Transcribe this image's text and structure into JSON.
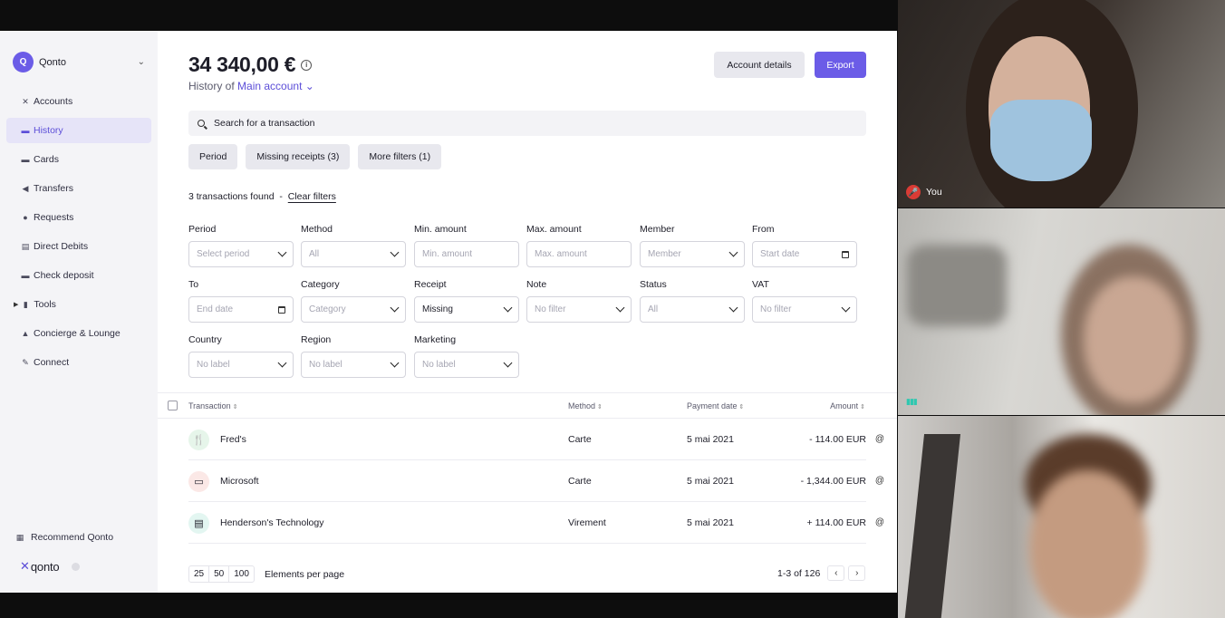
{
  "org": {
    "initial": "Q",
    "name": "Qonto"
  },
  "nav": [
    {
      "label": "Accounts",
      "icon": "accounts-icon",
      "glyph": "✕"
    },
    {
      "label": "History",
      "icon": "history-icon",
      "glyph": "▬"
    },
    {
      "label": "Cards",
      "icon": "cards-icon",
      "glyph": "▬"
    },
    {
      "label": "Transfers",
      "icon": "transfers-icon",
      "glyph": "◀"
    },
    {
      "label": "Requests",
      "icon": "requests-icon",
      "glyph": "●"
    },
    {
      "label": "Direct Debits",
      "icon": "direct-debits-icon",
      "glyph": "▤"
    },
    {
      "label": "Check deposit",
      "icon": "check-deposit-icon",
      "glyph": "▬"
    },
    {
      "label": "Tools",
      "icon": "tools-icon",
      "glyph": "▮"
    },
    {
      "label": "Concierge & Lounge",
      "icon": "concierge-icon",
      "glyph": "▲"
    },
    {
      "label": "Connect",
      "icon": "connect-icon",
      "glyph": "✎"
    }
  ],
  "recommend": {
    "label": "Recommend Qonto"
  },
  "brand": {
    "word": "qonto"
  },
  "header": {
    "balance": "34 340,00 €",
    "history_prefix": "History of",
    "account": "Main account",
    "details_label": "Account details",
    "export_label": "Export"
  },
  "search": {
    "placeholder": "Search for a transaction"
  },
  "chips": [
    "Period",
    "Missing receipts (3)",
    "More filters (1)"
  ],
  "results": {
    "found": "3 transactions found",
    "sep": "-",
    "clear": "Clear filters"
  },
  "filters": [
    {
      "label": "Period",
      "value": "Select period",
      "kind": "select"
    },
    {
      "label": "Method",
      "value": "All",
      "kind": "select"
    },
    {
      "label": "Min. amount",
      "value": "Min. amount",
      "kind": "input"
    },
    {
      "label": "Max. amount",
      "value": "Max. amount",
      "kind": "input"
    },
    {
      "label": "Member",
      "value": "Member",
      "kind": "select"
    },
    {
      "label": "From",
      "value": "Start date",
      "kind": "date"
    },
    {
      "label": "To",
      "value": "End date",
      "kind": "date"
    },
    {
      "label": "Category",
      "value": "Category",
      "kind": "select"
    },
    {
      "label": "Receipt",
      "value": "Missing",
      "kind": "select",
      "set": true
    },
    {
      "label": "Note",
      "value": "No filter",
      "kind": "select"
    },
    {
      "label": "Status",
      "value": "All",
      "kind": "select"
    },
    {
      "label": "VAT",
      "value": "No filter",
      "kind": "select"
    },
    {
      "label": "Country",
      "value": "No label",
      "kind": "select"
    },
    {
      "label": "Region",
      "value": "No label",
      "kind": "select"
    },
    {
      "label": "Marketing",
      "value": "No label",
      "kind": "select"
    }
  ],
  "table": {
    "columns": {
      "transaction": "Transaction",
      "method": "Method",
      "payment_date": "Payment date",
      "amount": "Amount"
    },
    "rows": [
      {
        "merchant": "Fred's",
        "method": "Carte",
        "date": "5 mai 2021",
        "amount": "- 114.00 EUR",
        "icon": "restaurant-icon",
        "glyph": "🍴",
        "color": "#e6f5ea"
      },
      {
        "merchant": "Microsoft",
        "method": "Carte",
        "date": "5 mai 2021",
        "amount": "- 1,344.00 EUR",
        "icon": "computer-icon",
        "glyph": "▭",
        "color": "#fbe8e6"
      },
      {
        "merchant": "Henderson's Technology",
        "method": "Virement",
        "date": "5 mai 2021",
        "amount": "+ 114.00 EUR",
        "icon": "document-icon",
        "glyph": "▤",
        "color": "#e3f6f1"
      }
    ]
  },
  "pagination": {
    "sizes": [
      "25",
      "50",
      "100"
    ],
    "per_label": "Elements per page",
    "range": "1-3 of 126"
  },
  "video": {
    "self_label": "You"
  },
  "colors": {
    "accent": "#6b5ce7",
    "muted_red": "#d93b35"
  }
}
